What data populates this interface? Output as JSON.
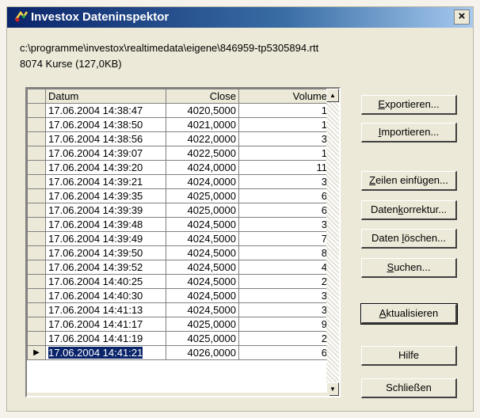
{
  "window": {
    "title": "Investox Dateninspektor",
    "close_glyph": "×",
    "icon": "app-logo-icon"
  },
  "info": {
    "file_path": "c:\\programme\\investox\\realtimedata\\eigene\\846959-tp5305894.rtt",
    "record_count": "8074 Kurse (127,0KB)"
  },
  "grid": {
    "columns": [
      "Datum",
      "Close",
      "Volume"
    ],
    "current_row_marker": "▶",
    "rows": [
      {
        "datum": "17.06.2004 14:38:47",
        "close": "4020,5000",
        "volume": "1"
      },
      {
        "datum": "17.06.2004 14:38:50",
        "close": "4021,0000",
        "volume": "1"
      },
      {
        "datum": "17.06.2004 14:38:56",
        "close": "4022,0000",
        "volume": "3"
      },
      {
        "datum": "17.06.2004 14:39:07",
        "close": "4022,5000",
        "volume": "1"
      },
      {
        "datum": "17.06.2004 14:39:20",
        "close": "4024,0000",
        "volume": "11"
      },
      {
        "datum": "17.06.2004 14:39:21",
        "close": "4024,0000",
        "volume": "3"
      },
      {
        "datum": "17.06.2004 14:39:35",
        "close": "4025,0000",
        "volume": "6"
      },
      {
        "datum": "17.06.2004 14:39:39",
        "close": "4025,0000",
        "volume": "6"
      },
      {
        "datum": "17.06.2004 14:39:48",
        "close": "4024,5000",
        "volume": "3"
      },
      {
        "datum": "17.06.2004 14:39:49",
        "close": "4024,5000",
        "volume": "7"
      },
      {
        "datum": "17.06.2004 14:39:50",
        "close": "4024,5000",
        "volume": "8"
      },
      {
        "datum": "17.06.2004 14:39:52",
        "close": "4024,5000",
        "volume": "4"
      },
      {
        "datum": "17.06.2004 14:40:25",
        "close": "4024,5000",
        "volume": "2"
      },
      {
        "datum": "17.06.2004 14:40:30",
        "close": "4024,5000",
        "volume": "3"
      },
      {
        "datum": "17.06.2004 14:41:13",
        "close": "4024,5000",
        "volume": "3"
      },
      {
        "datum": "17.06.2004 14:41:17",
        "close": "4025,0000",
        "volume": "9"
      },
      {
        "datum": "17.06.2004 14:41:19",
        "close": "4025,0000",
        "volume": "2"
      },
      {
        "datum": "17.06.2004 14:41:21",
        "close": "4026,0000",
        "volume": "6",
        "selected": true
      }
    ]
  },
  "buttons": [
    {
      "name": "export-button",
      "label": "Exportieren...",
      "mnemonic": "E"
    },
    {
      "name": "import-button",
      "label": "Importieren...",
      "mnemonic": "I"
    },
    {
      "name": "insert-rows-button",
      "label": "Zeilen einfügen...",
      "mnemonic": "Z"
    },
    {
      "name": "data-correction-button",
      "label": "Datenkorrektur...",
      "mnemonic": "k"
    },
    {
      "name": "delete-data-button",
      "label": "Daten löschen...",
      "mnemonic": "l"
    },
    {
      "name": "search-button",
      "label": "Suchen...",
      "mnemonic": "S"
    },
    {
      "name": "refresh-button",
      "label": "Aktualisieren",
      "mnemonic": "A",
      "default": true
    },
    {
      "name": "help-button",
      "label": "Hilfe"
    },
    {
      "name": "close-dialog-button",
      "label": "Schließen"
    }
  ],
  "colors": {
    "title_bar_start": "#0a246a",
    "title_bar_end": "#a6caf0",
    "selection": "#0a246a",
    "dialog_face": "#ece9d8"
  }
}
